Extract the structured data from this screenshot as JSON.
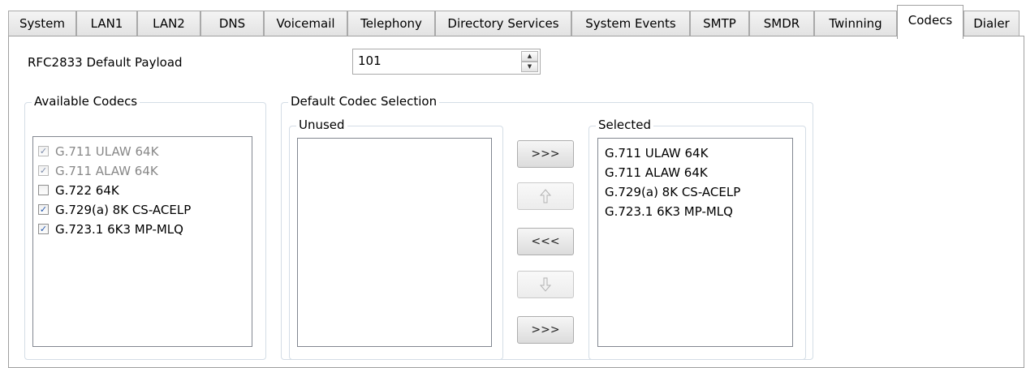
{
  "tabs": [
    {
      "label": "System"
    },
    {
      "label": "LAN1"
    },
    {
      "label": "LAN2"
    },
    {
      "label": "DNS"
    },
    {
      "label": "Voicemail"
    },
    {
      "label": "Telephony"
    },
    {
      "label": "Directory Services"
    },
    {
      "label": "System Events"
    },
    {
      "label": "SMTP"
    },
    {
      "label": "SMDR"
    },
    {
      "label": "Twinning"
    },
    {
      "label": "Codecs"
    },
    {
      "label": "Dialer"
    }
  ],
  "active_tab": "Codecs",
  "payload": {
    "label": "RFC2833 Default Payload",
    "value": "101"
  },
  "available": {
    "title": "Available Codecs",
    "items": [
      {
        "label": "G.711 ULAW 64K",
        "checked": true,
        "enabled": false
      },
      {
        "label": "G.711 ALAW 64K",
        "checked": true,
        "enabled": false
      },
      {
        "label": "G.722 64K",
        "checked": false,
        "enabled": true
      },
      {
        "label": "G.729(a) 8K CS-ACELP",
        "checked": true,
        "enabled": true
      },
      {
        "label": "G.723.1 6K3 MP-MLQ",
        "checked": true,
        "enabled": true
      }
    ]
  },
  "default_selection": {
    "title": "Default Codec Selection",
    "unused": {
      "title": "Unused",
      "items": []
    },
    "selected": {
      "title": "Selected",
      "items": [
        "G.711 ULAW 64K",
        "G.711 ALAW 64K",
        "G.729(a) 8K CS-ACELP",
        "G.723.1 6K3 MP-MLQ"
      ]
    },
    "buttons": {
      "add": ">>>",
      "remove": "<<<",
      "add_all": ">>>",
      "up_icon": "arrow-up-icon",
      "down_icon": "arrow-down-icon"
    }
  },
  "checkmark": "✓"
}
